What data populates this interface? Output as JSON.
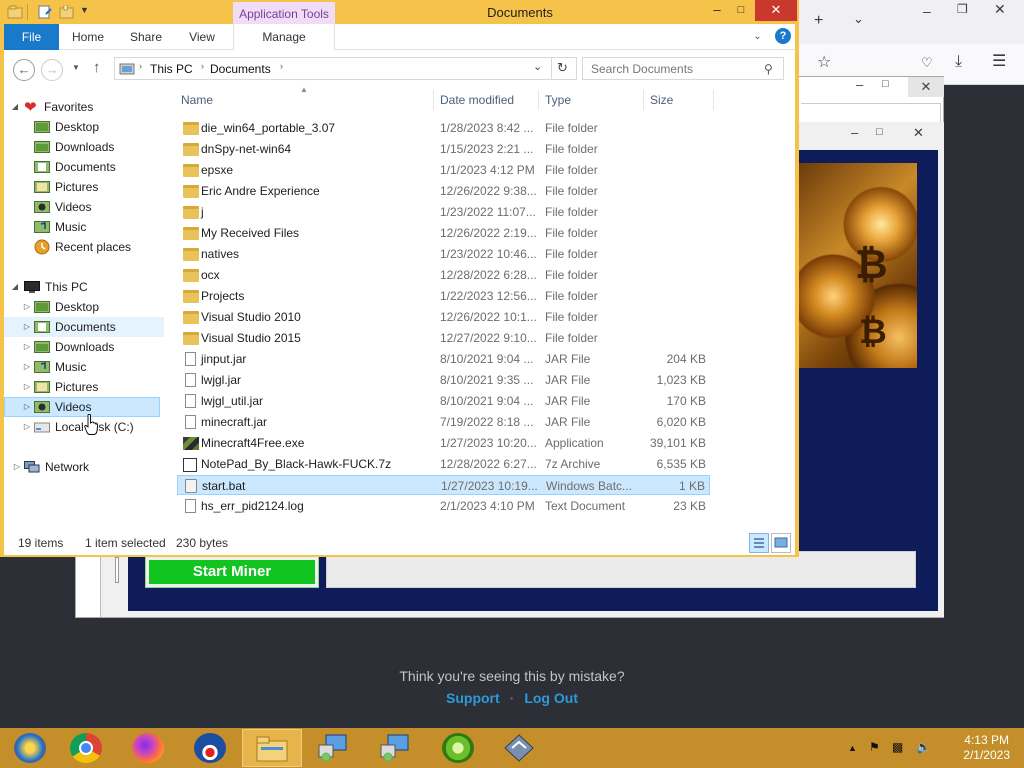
{
  "explorer": {
    "title": "Documents",
    "context_tab": "Application Tools",
    "ribbon_tabs": [
      "File",
      "Home",
      "Share",
      "View",
      "Manage"
    ],
    "breadcrumb": [
      "This PC",
      "Documents"
    ],
    "search_placeholder": "Search Documents",
    "columns": {
      "name": "Name",
      "date": "Date modified",
      "type": "Type",
      "size": "Size"
    },
    "nav": {
      "favorites": "Favorites",
      "fav_items": [
        "Desktop",
        "Downloads",
        "Documents",
        "Pictures",
        "Videos",
        "Music",
        "Recent places"
      ],
      "thispc": "This PC",
      "pc_items": [
        "Desktop",
        "Documents",
        "Downloads",
        "Music",
        "Pictures",
        "Videos",
        "Local Disk (C:)"
      ],
      "network": "Network"
    },
    "files": [
      {
        "name": "die_win64_portable_3.07",
        "date": "1/28/2023 8:42 ...",
        "type": "File folder",
        "size": "",
        "icon": "folder"
      },
      {
        "name": "dnSpy-net-win64",
        "date": "1/15/2023 2:21 ...",
        "type": "File folder",
        "size": "",
        "icon": "folder"
      },
      {
        "name": "epsxe",
        "date": "1/1/2023 4:12 PM",
        "type": "File folder",
        "size": "",
        "icon": "folder"
      },
      {
        "name": "Eric Andre Experience",
        "date": "12/26/2022 9:38...",
        "type": "File folder",
        "size": "",
        "icon": "folder"
      },
      {
        "name": "j",
        "date": "1/23/2022 11:07...",
        "type": "File folder",
        "size": "",
        "icon": "folder"
      },
      {
        "name": "My Received Files",
        "date": "12/26/2022 2:19...",
        "type": "File folder",
        "size": "",
        "icon": "folder"
      },
      {
        "name": "natives",
        "date": "1/23/2022 10:46...",
        "type": "File folder",
        "size": "",
        "icon": "folder"
      },
      {
        "name": "ocx",
        "date": "12/28/2022 6:28...",
        "type": "File folder",
        "size": "",
        "icon": "folder"
      },
      {
        "name": "Projects",
        "date": "1/22/2023 12:56...",
        "type": "File folder",
        "size": "",
        "icon": "folder"
      },
      {
        "name": "Visual Studio 2010",
        "date": "12/26/2022 10:1...",
        "type": "File folder",
        "size": "",
        "icon": "folder"
      },
      {
        "name": "Visual Studio 2015",
        "date": "12/27/2022 9:10...",
        "type": "File folder",
        "size": "",
        "icon": "folder"
      },
      {
        "name": "jinput.jar",
        "date": "8/10/2021 9:04 ...",
        "type": "JAR File",
        "size": "204 KB",
        "icon": "doc"
      },
      {
        "name": "lwjgl.jar",
        "date": "8/10/2021 9:35 ...",
        "type": "JAR File",
        "size": "1,023 KB",
        "icon": "doc"
      },
      {
        "name": "lwjgl_util.jar",
        "date": "8/10/2021 9:04 ...",
        "type": "JAR File",
        "size": "170 KB",
        "icon": "doc"
      },
      {
        "name": "minecraft.jar",
        "date": "7/19/2022 8:18 ...",
        "type": "JAR File",
        "size": "6,020 KB",
        "icon": "doc"
      },
      {
        "name": "Minecraft4Free.exe",
        "date": "1/27/2023 10:20...",
        "type": "Application",
        "size": "39,101 KB",
        "icon": "exe"
      },
      {
        "name": "NotePad_By_Black-Hawk-FUCK.7z",
        "date": "12/28/2022 6:27...",
        "type": "7z Archive",
        "size": "6,535 KB",
        "icon": "7z"
      },
      {
        "name": "start.bat",
        "date": "1/27/2023 10:19...",
        "type": "Windows Batc...",
        "size": "1 KB",
        "icon": "bat"
      },
      {
        "name": "hs_err_pid2124.log",
        "date": "2/1/2023 4:10 PM",
        "type": "Text Document",
        "size": "23 KB",
        "icon": "doc"
      }
    ],
    "status": {
      "count": "19 items",
      "selected": "1 item selected",
      "bytes": "230 bytes"
    }
  },
  "miner": {
    "start_button": "Start Miner"
  },
  "page": {
    "mistake": "Think you're seeing this by mistake?",
    "support": "Support",
    "logout": "Log Out",
    "separator": "·"
  },
  "taskbar": {
    "time": "4:13 PM",
    "date": "2/1/2023"
  }
}
